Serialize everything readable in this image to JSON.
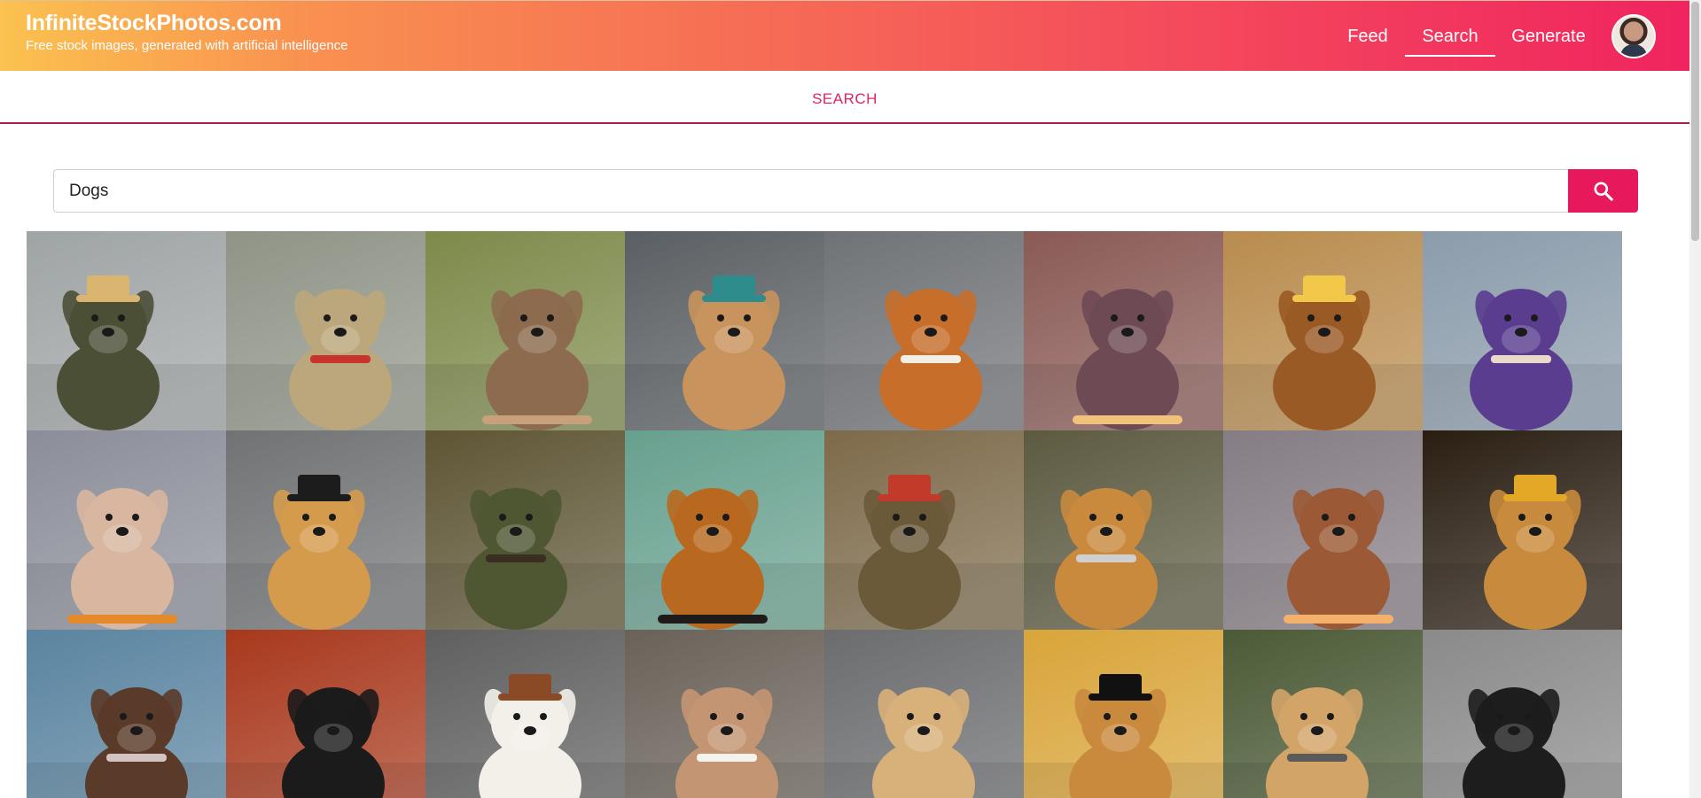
{
  "brand": {
    "title": "InfiniteStockPhotos.com",
    "subtitle": "Free stock images, generated with artificial intelligence"
  },
  "nav": {
    "items": [
      "Feed",
      "Search",
      "Generate"
    ],
    "active": "Search"
  },
  "page": {
    "heading": "SEARCH"
  },
  "search": {
    "value": "Dogs"
  },
  "colors": {
    "accent": "#e8185c",
    "gradient_start": "#fbc24f",
    "gradient_end": "#f0245f"
  },
  "results": [
    {
      "subject": "dog-in-military-uniform",
      "bg": "#9fa4a5",
      "fg": "#4b4f36",
      "accent": "#d9b56f"
    },
    {
      "subject": "dog-in-officer-uniform",
      "bg": "#8f9487",
      "fg": "#bba77b",
      "accent": "#c8342b"
    },
    {
      "subject": "two-dogs-howling",
      "bg": "#7d8a4a",
      "fg": "#8c6b4e",
      "accent": "#c9a07c"
    },
    {
      "subject": "puppy-on-skateboard",
      "bg": "#5a5f63",
      "fg": "#c8935c",
      "accent": "#2f8c8c"
    },
    {
      "subject": "pomeranian-on-skateboard",
      "bg": "#6f7276",
      "fg": "#c66e2a",
      "accent": "#f3efe6"
    },
    {
      "subject": "painted-wolfish-dog",
      "bg": "#8a5a55",
      "fg": "#6e4a55",
      "accent": "#f2c27a"
    },
    {
      "subject": "painted-mastiff",
      "bg": "#b98c4e",
      "fg": "#9a5a25",
      "accent": "#f1c84a"
    },
    {
      "subject": "dog-in-purple-sweater",
      "bg": "#8b9cab",
      "fg": "#5a3d8f",
      "accent": "#e9d9c9"
    },
    {
      "subject": "tiny-dog-on-road",
      "bg": "#8b8e99",
      "fg": "#d8b6a0",
      "accent": "#e58a2a"
    },
    {
      "subject": "golden-retriever-top-hat",
      "bg": "#707274",
      "fg": "#d59b4d",
      "accent": "#1c1c1c"
    },
    {
      "subject": "dog-in-army-jacket",
      "bg": "#5e5534",
      "fg": "#4f5632",
      "accent": "#3a2e22"
    },
    {
      "subject": "golden-dog-closeup",
      "bg": "#67a08e",
      "fg": "#b9691f",
      "accent": "#1f1b1a"
    },
    {
      "subject": "dog-general-portrait",
      "bg": "#7d6a4a",
      "fg": "#6b5a3a",
      "accent": "#c23a2a"
    },
    {
      "subject": "golden-retriever-white-hat",
      "bg": "#5c5a40",
      "fg": "#c98a3e",
      "accent": "#cfcfcf"
    },
    {
      "subject": "painted-brown-dog",
      "bg": "#857c84",
      "fg": "#9b5a35",
      "accent": "#f3b16b"
    },
    {
      "subject": "retriever-gold-top-hat",
      "bg": "#2a1e12",
      "fg": "#c88a3c",
      "accent": "#e3a826"
    },
    {
      "subject": "dog-on-cliff-sky",
      "bg": "#5a84a0",
      "fg": "#5a3a28",
      "accent": "#d3c3c3"
    },
    {
      "subject": "black-white-spaniel",
      "bg": "#a8381c",
      "fg": "#1b1b1b",
      "accent": "#f2f2f2"
    },
    {
      "subject": "running-small-dog",
      "bg": "#5f5f60",
      "fg": "#f3f0ea",
      "accent": "#8a4a25"
    },
    {
      "subject": "happy-mixed-breed",
      "bg": "#6a6259",
      "fg": "#c49572",
      "accent": "#f6f3ee"
    },
    {
      "subject": "puppy-on-skateboard-2",
      "bg": "#6b6c6e",
      "fg": "#d8b07a",
      "accent": "#2a6fb0"
    },
    {
      "subject": "retriever-black-top-hat",
      "bg": "#d9a53a",
      "fg": "#c98a3e",
      "accent": "#111111"
    },
    {
      "subject": "terrier-on-street",
      "bg": "#4b5a36",
      "fg": "#d3a468",
      "accent": "#5a5a5a"
    },
    {
      "subject": "black-dog-gray-bg",
      "bg": "#8a8a8a",
      "fg": "#1d1d1d",
      "accent": "#f1f1f1"
    }
  ]
}
